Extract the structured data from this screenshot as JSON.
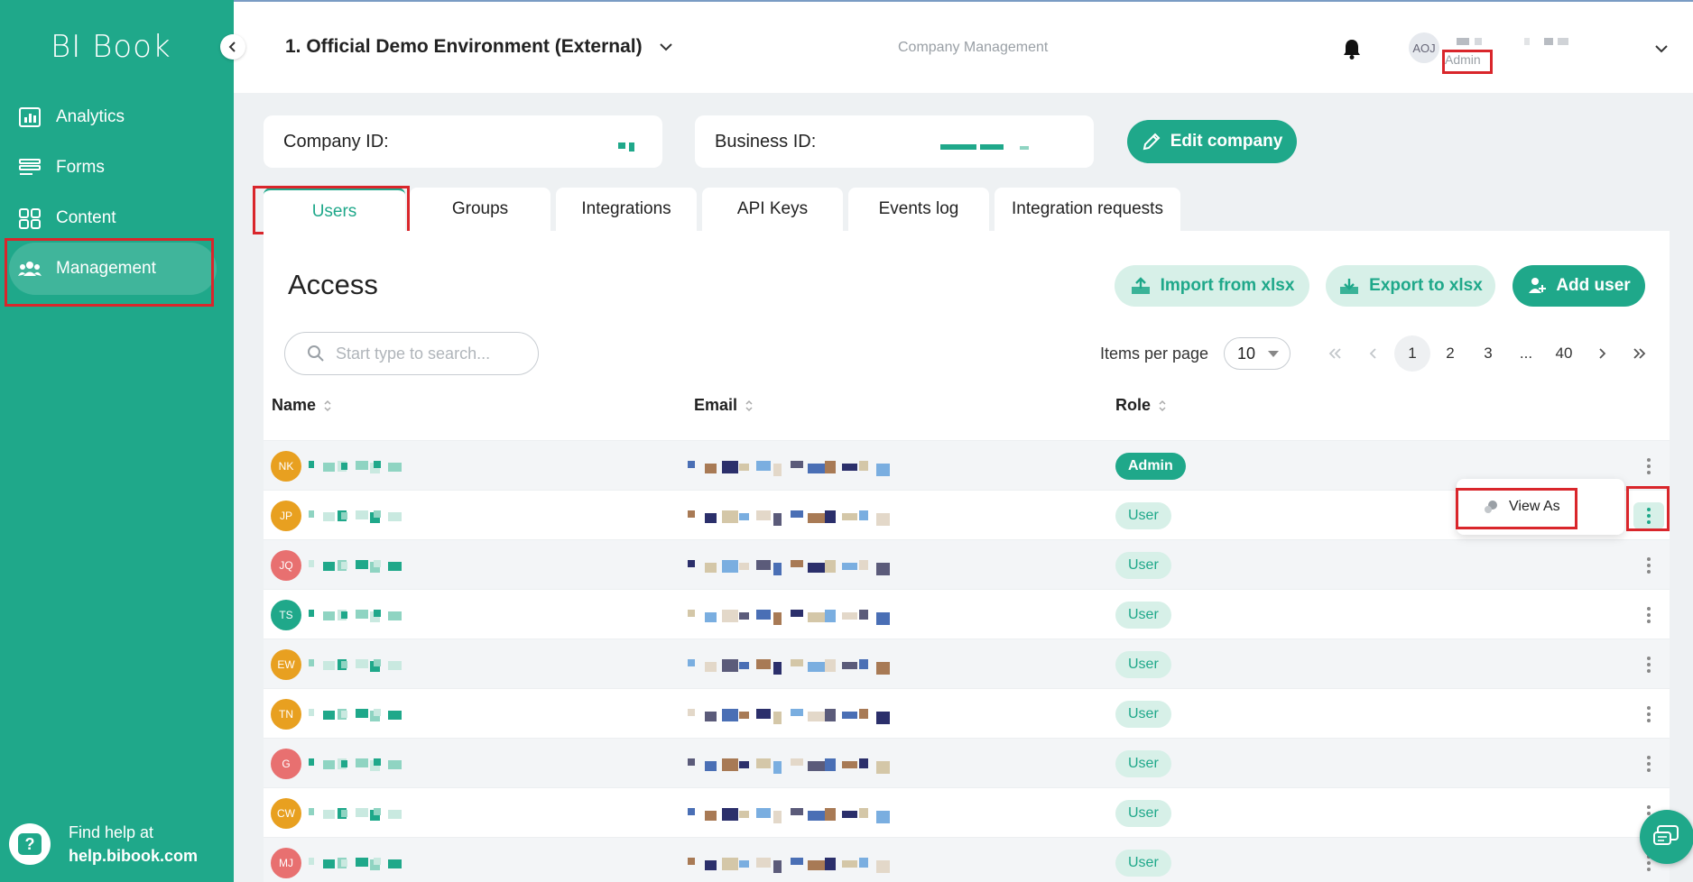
{
  "sidebar": {
    "logo": "BI Book",
    "items": [
      {
        "label": "Analytics",
        "icon": "analytics-icon"
      },
      {
        "label": "Forms",
        "icon": "forms-icon"
      },
      {
        "label": "Content",
        "icon": "content-icon"
      },
      {
        "label": "Management",
        "icon": "users-group-icon",
        "active": true
      }
    ],
    "help": {
      "line1": "Find help at",
      "line2": "help.bibook.com"
    }
  },
  "header": {
    "environment": "1. Official Demo Environment (External)",
    "page_label": "Company Management",
    "user_initials": "AOJ",
    "user_role": "Admin"
  },
  "company": {
    "company_id_label": "Company ID:",
    "business_id_label": "Business ID:",
    "edit_button": "Edit company"
  },
  "tabs": [
    {
      "label": "Users",
      "active": true
    },
    {
      "label": "Groups"
    },
    {
      "label": "Integrations"
    },
    {
      "label": "API Keys"
    },
    {
      "label": "Events log"
    },
    {
      "label": "Integration requests"
    }
  ],
  "access": {
    "title": "Access",
    "import_button": "Import from xlsx",
    "export_button": "Export to xlsx",
    "add_button": "Add user",
    "search_placeholder": "Start type to search...",
    "items_per_page_label": "Items per page",
    "items_per_page": "10",
    "pagination": [
      "1",
      "2",
      "3",
      "...",
      "40"
    ],
    "current_page": "1",
    "columns": {
      "name": "Name",
      "email": "Email",
      "role": "Role"
    }
  },
  "users": [
    {
      "initials": "NK",
      "color": "#e8a020",
      "role": "Admin"
    },
    {
      "initials": "JP",
      "color": "#e8a020",
      "role": "User"
    },
    {
      "initials": "JQ",
      "color": "#e87070",
      "role": "User"
    },
    {
      "initials": "TS",
      "color": "#1fa88a",
      "role": "User"
    },
    {
      "initials": "EW",
      "color": "#e8a020",
      "role": "User"
    },
    {
      "initials": "TN",
      "color": "#e8a020",
      "role": "User"
    },
    {
      "initials": "G",
      "color": "#e87070",
      "role": "User"
    },
    {
      "initials": "CW",
      "color": "#e8a020",
      "role": "User"
    },
    {
      "initials": "MJ",
      "color": "#e87070",
      "role": "User"
    }
  ],
  "context_menu": {
    "view_as": "View As"
  },
  "colors": {
    "brand": "#1fa88a",
    "highlight": "#d9262b"
  }
}
